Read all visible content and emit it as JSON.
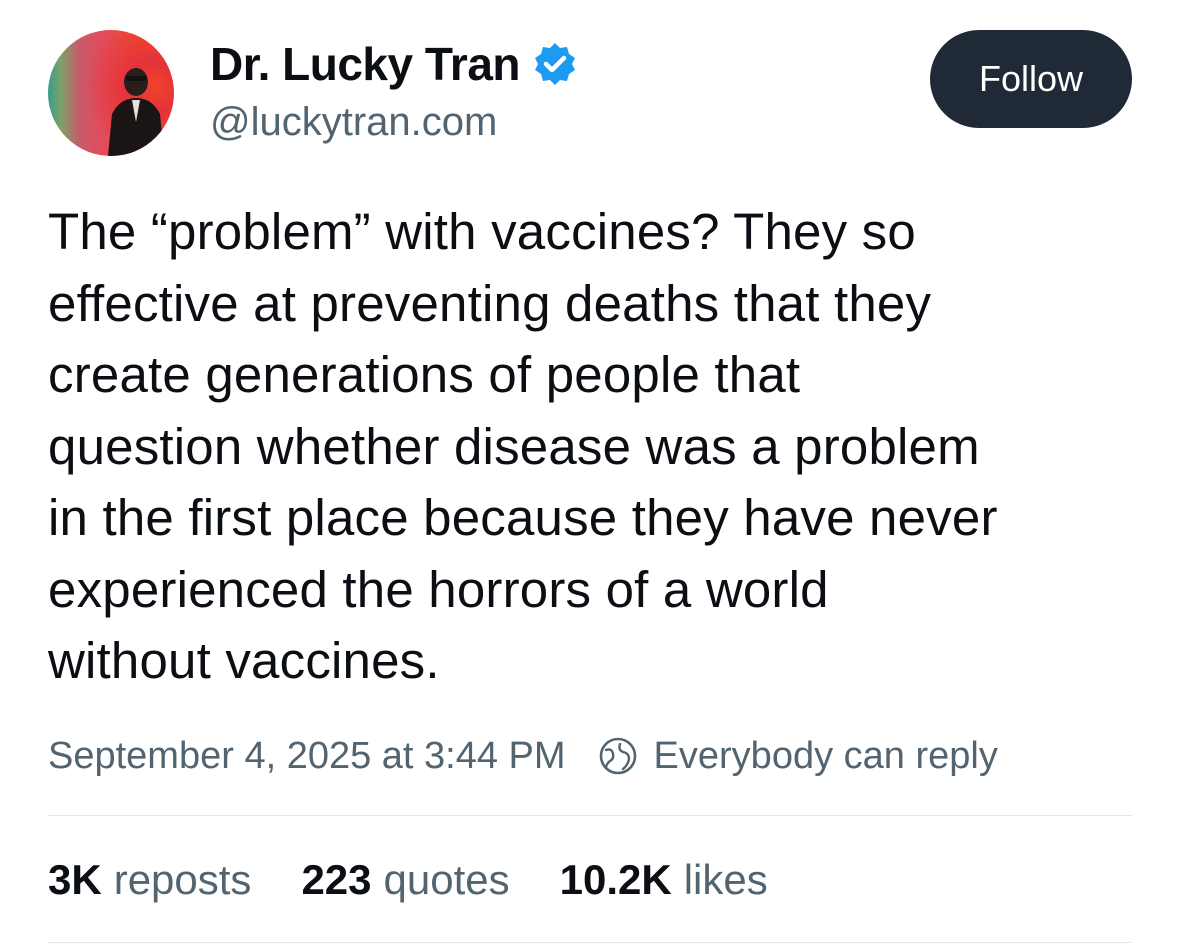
{
  "author": {
    "display_name": "Dr. Lucky Tran",
    "handle": "@luckytran.com",
    "verified_icon": "verified-badge-icon",
    "accent_color": "#1d9bf0"
  },
  "follow_button": {
    "label": "Follow",
    "background": "#1f2a36"
  },
  "post": {
    "text": "The “problem” with vaccines? They so\neffective at preventing deaths that they\ncreate generations of people that\nquestion whether disease was a problem\nin the first place because they have never\nexperienced the horrors of a world\nwithout vaccines.",
    "timestamp": "September 4, 2025 at 3:44 PM",
    "reply_setting": "Everybody can reply",
    "reply_icon": "globe-icon"
  },
  "stats": [
    {
      "value": "3K",
      "label": "reposts"
    },
    {
      "value": "223",
      "label": "quotes"
    },
    {
      "value": "10.2K",
      "label": "likes"
    }
  ]
}
